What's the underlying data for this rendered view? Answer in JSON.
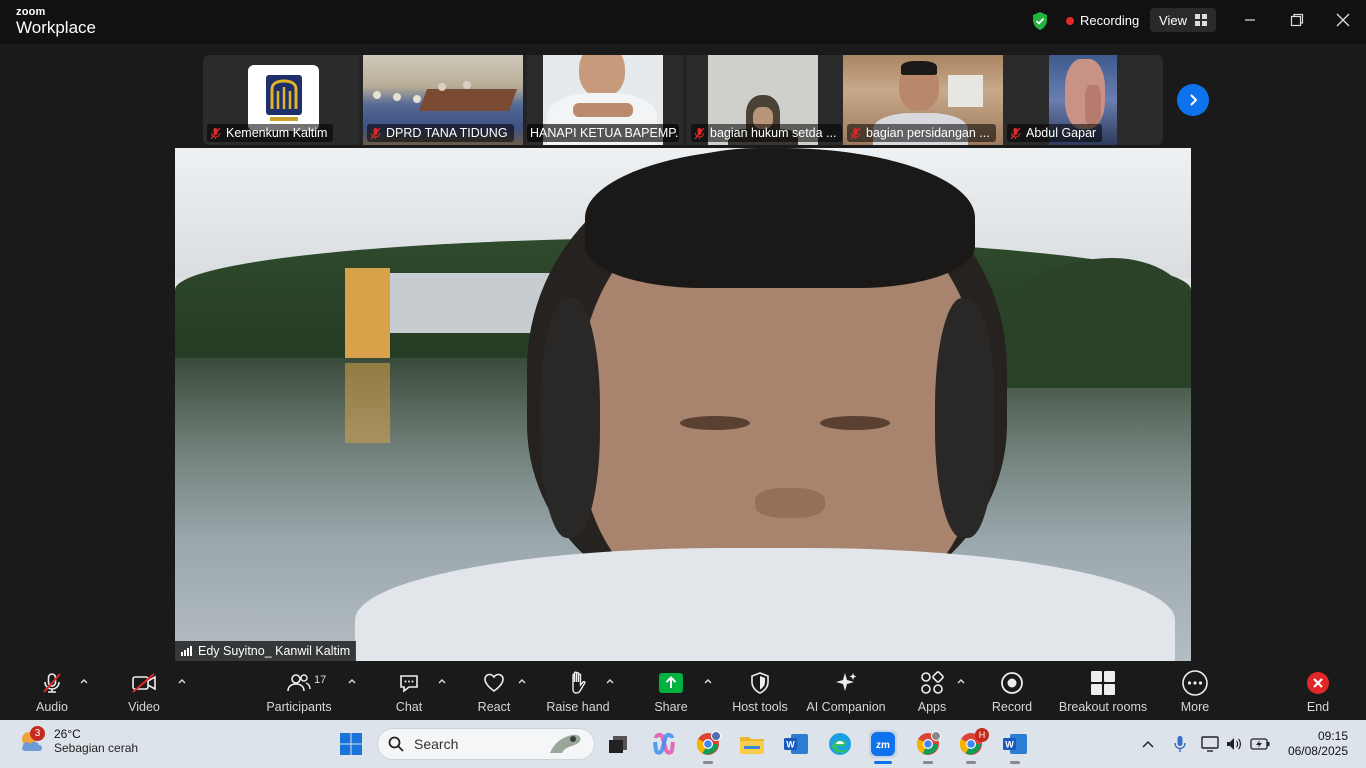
{
  "app": {
    "brand_top": "zoom",
    "brand_bottom": "Workplace",
    "recording_label": "Recording",
    "view_label": "View"
  },
  "participants_strip": [
    {
      "name": "Kemenkum Kaltim",
      "muted": true
    },
    {
      "name": "DPRD TANA TIDUNG",
      "muted": true
    },
    {
      "name": "HANAPI KETUA BAPEMP...",
      "muted": false
    },
    {
      "name": "bagian hukum setda ...",
      "muted": true
    },
    {
      "name": "bagian persidangan ...",
      "muted": true
    },
    {
      "name": "Abdul Gapar",
      "muted": true
    }
  ],
  "main_video": {
    "speaker_name": "Edy Suyitno_ Kanwil Kaltim"
  },
  "toolbar": {
    "audio": "Audio",
    "video": "Video",
    "participants": "Participants",
    "participants_count": "17",
    "chat": "Chat",
    "react": "React",
    "raise_hand": "Raise hand",
    "share": "Share",
    "host_tools": "Host tools",
    "ai_companion": "AI Companion",
    "apps": "Apps",
    "record": "Record",
    "breakout_rooms": "Breakout rooms",
    "more": "More",
    "end": "End"
  },
  "taskbar": {
    "weather_badge": "3",
    "temperature": "26°C",
    "weather_desc": "Sebagian cerah",
    "search_placeholder": "Search",
    "chrome_badge": "H",
    "time": "09:15",
    "date": "06/08/2025"
  },
  "colors": {
    "share_green": "#00b341",
    "zoom_blue": "#0e72ed",
    "end_red": "#e02828"
  }
}
